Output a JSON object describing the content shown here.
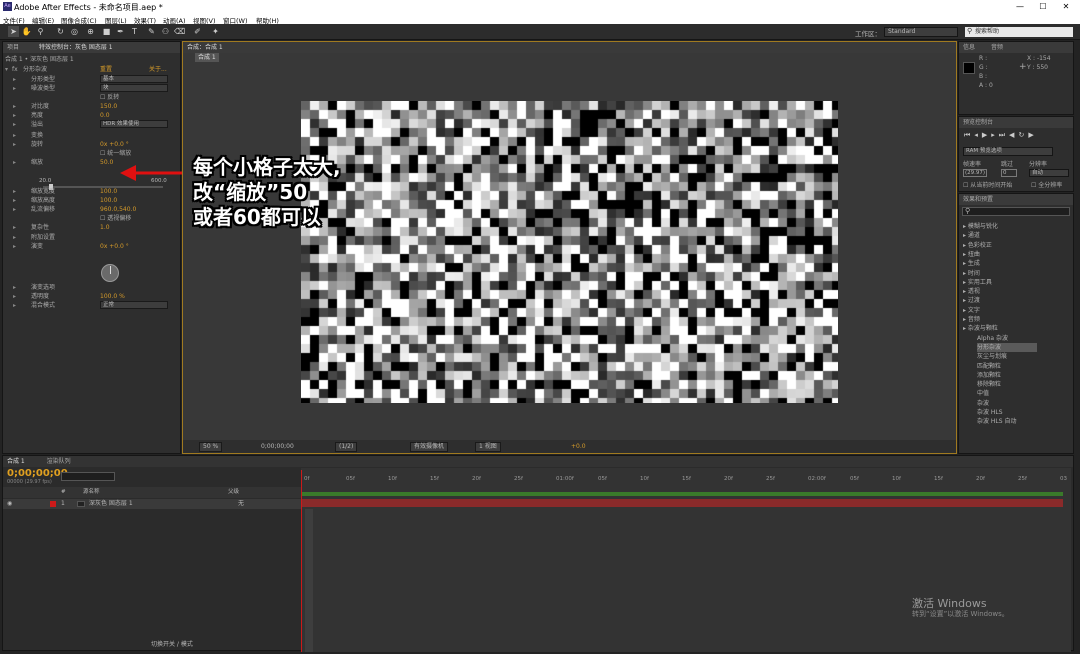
{
  "window": {
    "title": "Adobe After Effects - 未命名项目.aep *",
    "logo": "Ae",
    "min": "—",
    "max": "☐",
    "close": "✕"
  },
  "menu": [
    "文件(F)",
    "编辑(E)",
    "图像合成(C)",
    "图层(L)",
    "效果(T)",
    "动画(A)",
    "视图(V)",
    "窗口(W)",
    "帮助(H)"
  ],
  "toolbar": {
    "workspace_label": "工作区：",
    "workspace_value": "Standard",
    "search_placeholder": "搜索帮助"
  },
  "left_panel": {
    "tabs": [
      "项目",
      "特效控制台：灰色 固态层 1"
    ],
    "breadcrumb": "合成 1 • 深灰色 固态层 1",
    "effect_name": "分形杂波",
    "reset": "重置",
    "about": "关于...",
    "rows": [
      {
        "label": "分形类型",
        "dd": "基本"
      },
      {
        "label": "噪波类型",
        "dd": "块"
      },
      {
        "label": "",
        "check": "反转"
      },
      {
        "label": "对比度",
        "value": "150.0"
      },
      {
        "label": "亮度",
        "value": "0.0"
      },
      {
        "label": "溢出",
        "dd": "HDR 效果使用"
      },
      {
        "label": "变换"
      },
      {
        "label": "旋转",
        "value": "0x +0.0 °"
      },
      {
        "label": "",
        "check": "统一缩放"
      },
      {
        "label": "缩放",
        "value": "50.0"
      },
      {
        "label": "缩放宽度",
        "value": "100.0"
      },
      {
        "label": "缩放高度",
        "value": "100.0"
      },
      {
        "label": "乱流偏移",
        "value": "960.0,540.0"
      },
      {
        "label": "",
        "check": "透视偏移"
      },
      {
        "label": "复杂性",
        "value": "1.0"
      },
      {
        "label": "附加设置"
      },
      {
        "label": "演变",
        "value": "0x +0.0 °"
      },
      {
        "label": "演变选项"
      },
      {
        "label": "透明度",
        "value": "100.0 %"
      },
      {
        "label": "混合模式",
        "dd": "正常"
      }
    ],
    "slider_min": "20.0",
    "slider_max": "600.0",
    "slider_value": 0.05
  },
  "comp": {
    "tab": "合成：合成 1",
    "subtab": "合成 1",
    "zoom": "50 %",
    "timecode": "0;00;00;00",
    "quality": "(1/2)",
    "camera": "有效摄像机",
    "views": "1 视图",
    "exposure": "+0.0"
  },
  "annotation": {
    "line1": "每个小格子太大,",
    "line2": "改“缩放”50",
    "line3": "或者60都可以"
  },
  "info": {
    "tabs": [
      "信息",
      "音频"
    ],
    "r": "R :",
    "g": "G :",
    "b": "B :",
    "a": "A : 0",
    "x": "X : -154",
    "y": "Y : 550"
  },
  "preview": {
    "title": "预览控制台",
    "ram": "RAM 预览选项",
    "fps_label": "帧速率",
    "skip_label": "跳过",
    "res_label": "分辨率",
    "fps": "(29.97)",
    "skip": "0",
    "res": "自动",
    "from_current": "从当前时间开始",
    "full_screen": "全分辨率"
  },
  "effects": {
    "title": "效果和预置",
    "items": [
      "模糊与锐化",
      "通道",
      "色彩校正",
      "扭曲",
      "生成",
      "时间",
      "实用工具",
      "透视",
      "过渡",
      "文字",
      "音频",
      "杂波与颗粒"
    ],
    "sub": [
      "Alpha 杂波",
      "分形杂波",
      "灰尘与划痕",
      "匹配颗粒",
      "添加颗粒",
      "移除颗粒",
      "中值",
      "杂波",
      "杂波 HLS",
      "杂波 HLS 自动"
    ]
  },
  "timeline": {
    "tabs": [
      "合成 1",
      "渲染队列"
    ],
    "timecode": "0;00;00;00",
    "sub": "00000 (29.97 fps)",
    "layer_name": "深灰色 固态层 1",
    "layer_num": "1",
    "mode": "无",
    "source_col": "源名称",
    "parent_col": "父级",
    "toggle": "切换开关 / 模式",
    "ticks": [
      "0f",
      "05f",
      "10f",
      "15f",
      "20f",
      "25f",
      "01:00f",
      "05f",
      "10f",
      "15f",
      "20f",
      "25f",
      "02:00f",
      "05f",
      "10f",
      "15f",
      "20f",
      "25f",
      "03"
    ]
  },
  "watermark": {
    "line1": "激活 Windows",
    "line2": "转到“设置”以激活 Windows。"
  },
  "colors": {
    "accent": "#d49a2a",
    "red": "#cc1a1a",
    "layer_bar": "#8a2a2a"
  }
}
